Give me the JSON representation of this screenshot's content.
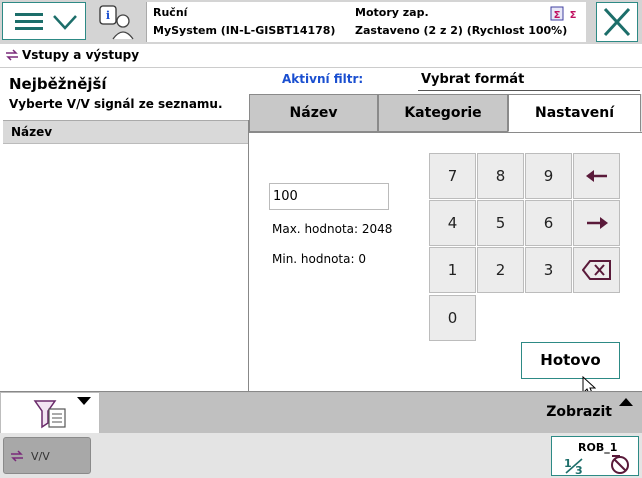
{
  "header": {
    "mode": "Ruční",
    "system": "MySystem (IN-L-GISBT14178)",
    "motors": "Motory zap.",
    "state": "Zastaveno (2 z 2) (Rychlost 100%)"
  },
  "breadcrumb": {
    "title": "Vstupy a výstupy"
  },
  "left_panel": {
    "title": "Nejběžnější",
    "subtitle": "Vyberte V/V signál ze seznamu.",
    "column_header": "Název"
  },
  "filter": {
    "active_label": "Aktivní filtr:",
    "format_label": "Vybrat formát"
  },
  "tabs": [
    {
      "label": "Název",
      "selected": false
    },
    {
      "label": "Kategorie",
      "selected": false
    },
    {
      "label": "Nastavení",
      "selected": true
    }
  ],
  "settings": {
    "value": "100",
    "max_text": "Max. hodnota: 2048",
    "min_text": "Min. hodnota: 0"
  },
  "keypad": {
    "keys": [
      "7",
      "8",
      "9",
      "4",
      "5",
      "6",
      "1",
      "2",
      "3",
      "0"
    ],
    "special_icons": [
      "arrow-left-icon",
      "arrow-right-icon",
      "backspace-icon"
    ]
  },
  "buttons": {
    "done": "Hotovo",
    "show": "Zobrazit"
  },
  "taskbar": {
    "io_label": "V/V",
    "robot_label": "ROB_1"
  },
  "colors": {
    "accent": "#2d8a85",
    "filter_blue": "#1a4fd0",
    "tab_selected": "#ffffff",
    "tab_inactive": "#c8c8c8"
  }
}
